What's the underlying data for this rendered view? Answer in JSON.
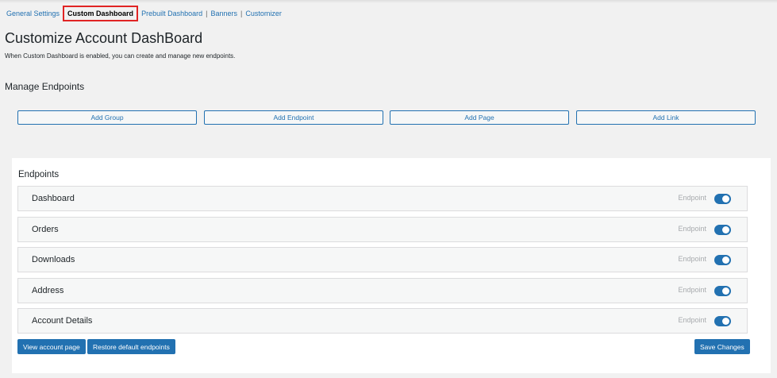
{
  "tabs": {
    "general": "General Settings",
    "custom": "Custom Dashboard",
    "prebuilt": "Prebuilt Dashboard",
    "banners": "Banners",
    "customizer": "Customizer",
    "sep": "|"
  },
  "title": "Customize Account DashBoard",
  "description": "When Custom Dashboard is enabled, you can create and manage new endpoints.",
  "manage_heading": "Manage Endpoints",
  "add_buttons": [
    "Add Group",
    "Add Endpoint",
    "Add Page",
    "Add Link"
  ],
  "endpoints_heading": "Endpoints",
  "endpoints": [
    {
      "label": "Dashboard",
      "type": "Endpoint",
      "enabled": true
    },
    {
      "label": "Orders",
      "type": "Endpoint",
      "enabled": true
    },
    {
      "label": "Downloads",
      "type": "Endpoint",
      "enabled": true
    },
    {
      "label": "Address",
      "type": "Endpoint",
      "enabled": true
    },
    {
      "label": "Account Details",
      "type": "Endpoint",
      "enabled": true
    }
  ],
  "buttons": {
    "view": "View account page",
    "restore": "Restore default endpoints",
    "save": "Save Changes"
  },
  "colors": {
    "accent": "#2271b1",
    "highlight": "#e02424"
  }
}
